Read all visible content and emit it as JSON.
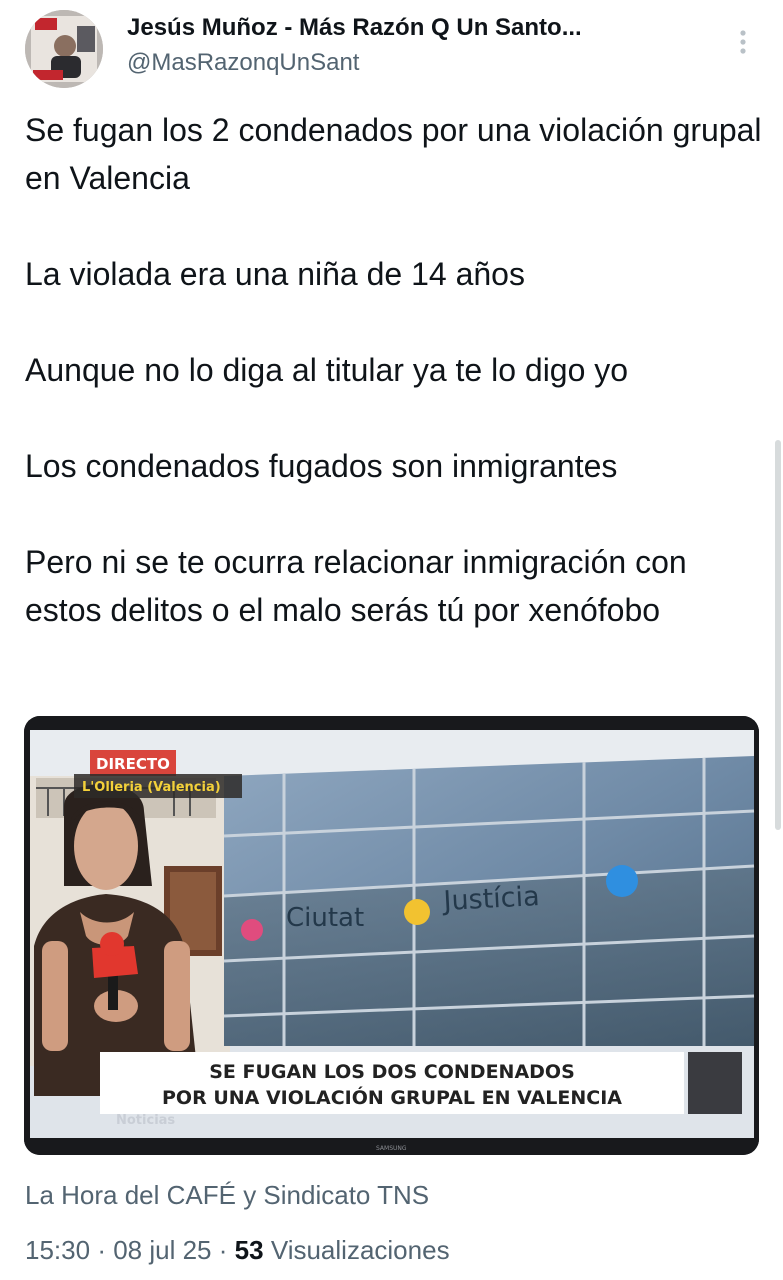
{
  "tweet": {
    "author_name": "Jesús Muñoz - Más Razón Q Un Santo...",
    "author_handle": "@MasRazonqUnSant",
    "more_icon": "more-vertical-icon",
    "paragraphs": [
      "Se fugan los 2 condenados por una violación grupal en Valencia",
      "La violada era una niña de 14 años",
      "Aunque no lo diga al titular ya te lo digo yo",
      "Los condenados fugados son inmigrantes",
      "Pero ni se te ocurra relacionar inmigración con estos delitos o el malo serás tú por xenófobo"
    ],
    "media": {
      "live_badge": "DIRECTO",
      "location": "L'Olleria (Valencia)",
      "building_sign_1": "Ciutat",
      "building_sign_2": "Justícia",
      "headline_line_1": "SE FUGAN LOS DOS CONDENADOS",
      "headline_line_2": "POR UNA VIOLACIÓN GRUPAL EN VALENCIA",
      "channel_brand": "Noticias",
      "tv_brand": "SAMSUNG"
    },
    "source": "La Hora del CAFÉ y Sindicato TNS",
    "time": "15:30",
    "date": "08 jul 25",
    "views_count": "53",
    "views_label": "Visualizaciones",
    "separator": "·"
  },
  "colors": {
    "text_primary": "#0f1419",
    "text_secondary": "#536471",
    "live_badge": "#d9453c",
    "headline_bg": "#ffffff"
  }
}
